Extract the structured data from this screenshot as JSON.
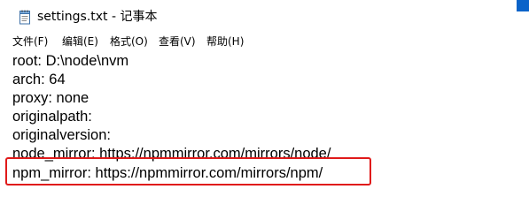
{
  "window": {
    "title": "settings.txt - 记事本",
    "icon": "notepad-icon",
    "accent_color": "#0a63c9"
  },
  "menu": {
    "items": [
      {
        "label": "文件(F)"
      },
      {
        "label": "编辑(E)"
      },
      {
        "label": "格式(O)"
      },
      {
        "label": "查看(V)"
      },
      {
        "label": "帮助(H)"
      }
    ]
  },
  "editor": {
    "lines": [
      "root: D:\\node\\nvm",
      "arch: 64",
      "proxy: none",
      "originalpath:",
      "originalversion:",
      "node_mirror: https://npmmirror.com/mirrors/node/",
      "npm_mirror: https://npmmirror.com/mirrors/npm/"
    ],
    "highlight_color": "#e01a1a"
  }
}
